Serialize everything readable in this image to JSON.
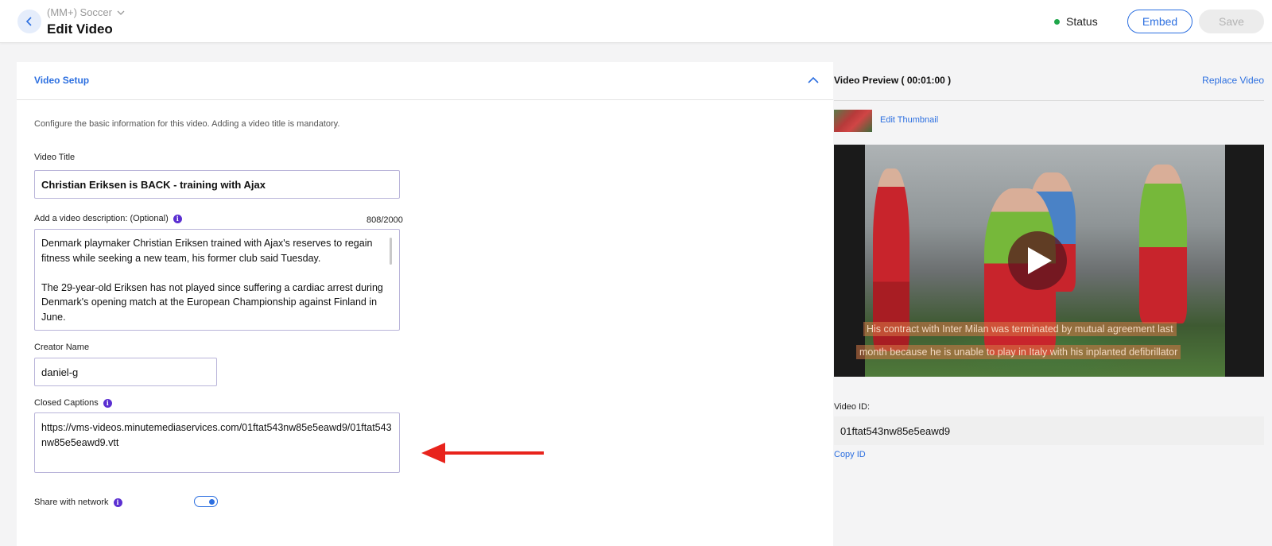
{
  "header": {
    "breadcrumb": "(MM+) Soccer",
    "title": "Edit Video",
    "status_label": "Status",
    "status_color": "#1ea64a",
    "embed_label": "Embed",
    "save_label": "Save"
  },
  "setup": {
    "section_title": "Video Setup",
    "intro": "Configure the basic information for this video. Adding a video title is mandatory.",
    "video_title_label": "Video Title",
    "video_title_value": "Christian Eriksen is BACK - training with Ajax",
    "description_label": "Add a video description: (Optional)",
    "description_count": "808/2000",
    "description_p1": "Denmark playmaker Christian Eriksen trained with Ajax's reserves to regain fitness while seeking a new team, his former club said Tuesday.",
    "description_p2": "The 29-year-old Eriksen has not played since suffering a cardiac arrest during Denmark's opening match at the European Championship against Finland in June.",
    "creator_label": "Creator Name",
    "creator_value": "daniel-g",
    "captions_label": "Closed Captions",
    "captions_value": "https://vms-videos.minutemediaservices.com/01ftat543nw85e5eawd9/01ftat543nw85e5eawd9.vtt",
    "share_label": "Share with network",
    "share_enabled": true
  },
  "preview": {
    "title": "Video Preview ( 00:01:00 )",
    "replace_label": "Replace Video",
    "edit_thumbnail_label": "Edit Thumbnail",
    "caption_line1": "His contract with Inter Milan was terminated by mutual agreement last",
    "caption_line2": "month because he is unable to play in Italy with his inplanted defibrillator",
    "video_id_label": "Video ID:",
    "video_id_value": "01ftat543nw85e5eawd9",
    "copy_id_label": "Copy ID"
  },
  "colors": {
    "accent": "#2c6fe0",
    "info_icon": "#5b2fd1",
    "annotation_arrow": "#e8231c"
  }
}
